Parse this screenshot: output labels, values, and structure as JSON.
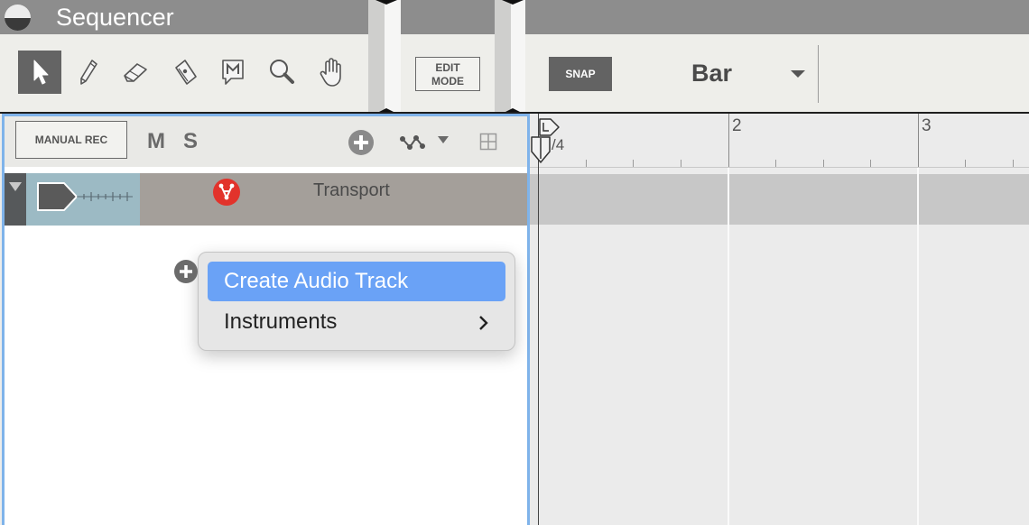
{
  "window": {
    "title": "Sequencer"
  },
  "toolbar": {
    "tools": [
      {
        "name": "select-tool",
        "icon": "arrow-pointer-icon",
        "active": true
      },
      {
        "name": "pencil-tool",
        "icon": "pencil-icon"
      },
      {
        "name": "eraser-tool",
        "icon": "eraser-icon"
      },
      {
        "name": "razor-tool",
        "icon": "razor-icon"
      },
      {
        "name": "mute-tool",
        "icon": "mute-speech-icon"
      },
      {
        "name": "magnify-tool",
        "icon": "magnifier-icon"
      },
      {
        "name": "hand-tool",
        "icon": "hand-icon"
      }
    ],
    "edit_mode_label": "EDIT\nMODE",
    "snap_label": "SNAP",
    "snap_value": "Bar"
  },
  "track_list": {
    "manual_rec_label": "MANUAL REC",
    "mute_label": "M",
    "solo_label": "S",
    "tracks": [
      {
        "name": "Transport",
        "color": "#9cbac4"
      }
    ]
  },
  "context_menu": {
    "items": [
      {
        "label": "Create Audio Track",
        "highlighted": true
      },
      {
        "label": "Instruments",
        "has_submenu": true
      }
    ]
  },
  "ruler": {
    "bars": [
      "2",
      "3"
    ],
    "time_signature": "/4"
  },
  "colors": {
    "accent": "#6aa2f6",
    "panel_focus_border": "#7fb3ea",
    "title_bar": "#8d8d8d",
    "transport_device": "#e2332b"
  }
}
